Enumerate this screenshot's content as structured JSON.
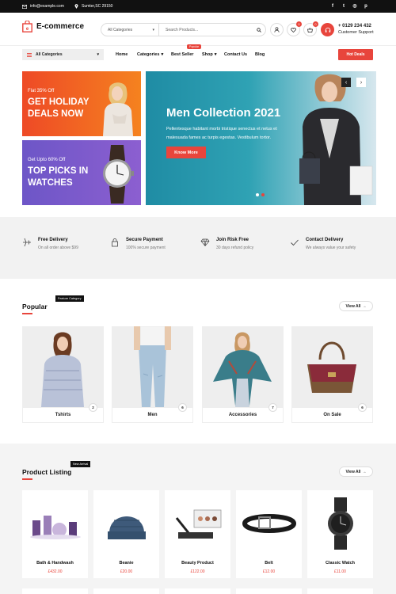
{
  "topbar": {
    "email": "info@example.com",
    "address": "Sumter,SC 29150",
    "social": [
      {
        "icon": "facebook-icon",
        "glyph": "f"
      },
      {
        "icon": "twitter-icon",
        "glyph": "t"
      },
      {
        "icon": "instagram-icon",
        "glyph": "◎"
      },
      {
        "icon": "pinterest-icon",
        "glyph": "p"
      }
    ]
  },
  "header": {
    "logo_text": "E-commerce",
    "search_category": "All Categories",
    "search_placeholder": "Search Products...",
    "wishlist_count": "0",
    "cart_count": "0",
    "phone": "+ 0129 234 432",
    "support_label": "Customer Support"
  },
  "nav": {
    "all_categories": "All Categories",
    "items": [
      "Home",
      "Categories",
      "Best Seller",
      "Shop",
      "Contact Us",
      "Blog"
    ],
    "popular_tag": "Popular",
    "hot_deals": "Hot Deals"
  },
  "banners": {
    "left1_small": "Flat 35% Off",
    "left1_big": "GET HOLIDAY DEALS NOW",
    "left2_small": "Get Upto 60% Off",
    "left2_big": "TOP PICKS IN WATCHES",
    "hero_title": "Men Collection 2021",
    "hero_text": "Pellentesque habitant morbi tristique senectus et netus et malesuada fames ac turpis egestas. Vestibulum tortor.",
    "hero_button": "Know More",
    "prev": "‹",
    "next": "›"
  },
  "features": [
    {
      "title": "Free Delivery",
      "sub": "On all order above $99",
      "icon": "plane-icon"
    },
    {
      "title": "Secure Payment",
      "sub": "100% secure payment",
      "icon": "lock-icon"
    },
    {
      "title": "Join Risk Free",
      "sub": "30 days refund policy",
      "icon": "diamond-icon"
    },
    {
      "title": "Contact Delivery",
      "sub": "We always value your safety",
      "icon": "check-icon"
    }
  ],
  "popular": {
    "tag": "Feature Category",
    "title": "Popular",
    "view_all": "View All",
    "categories": [
      {
        "label": "Tshirts",
        "count": "2"
      },
      {
        "label": "Men",
        "count": "6"
      },
      {
        "label": "Accessories",
        "count": "7"
      },
      {
        "label": "On Sale",
        "count": "6"
      }
    ]
  },
  "listing": {
    "tag": "New Arrival",
    "title": "Product Listing",
    "view_all": "View All",
    "products": [
      {
        "name": "Bath & Handwash",
        "price": "£432.00"
      },
      {
        "name": "Beanie",
        "price": "£20.00"
      },
      {
        "name": "Beauty Product",
        "price": "£122.00"
      },
      {
        "name": "Belt",
        "price": "£12.00"
      },
      {
        "name": "Classic Watch",
        "price": "£11.00"
      }
    ]
  },
  "colors": {
    "accent": "#e8453c",
    "dark": "#111111",
    "teal": "#1f8ca4",
    "orange": "#f5821f",
    "purple": "#7b59cc"
  }
}
